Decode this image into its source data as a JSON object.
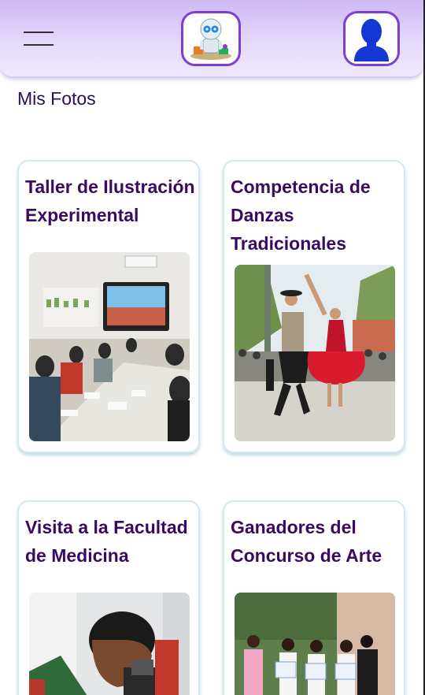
{
  "header": {
    "menu_icon": "hamburger-menu-icon",
    "logo_icon": "robot-mascot-logo",
    "avatar_icon": "user-avatar-icon"
  },
  "section_title": "Mis Fotos",
  "cards": [
    {
      "title": "Taller de Ilustración Experimental"
    },
    {
      "title": "Competencia de Danzas Tradicionales"
    },
    {
      "title": "Visita a la Facultad de Medicina"
    },
    {
      "title": "Ganadores del Concurso de Arte"
    }
  ],
  "colors": {
    "accent": "#7a3fd6",
    "title_text": "#3a0a63",
    "header_gradient_top": "#cdb9f4"
  }
}
